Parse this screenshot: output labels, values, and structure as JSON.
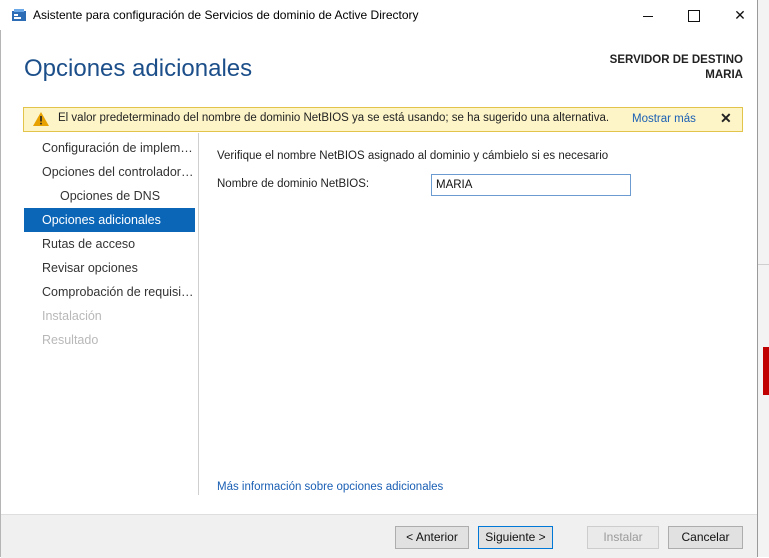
{
  "window": {
    "title": "Asistente para configuración de Servicios de dominio de Active Directory",
    "app_icon": "ad-wizard-icon"
  },
  "header": {
    "title": "Opciones adicionales",
    "dest_label": "SERVIDOR DE DESTINO",
    "dest_name": "MARIA"
  },
  "warning": {
    "icon": "warning-icon",
    "text": "El valor predeterminado del nombre de dominio NetBIOS ya se está usando; se ha sugerido una alternativa.",
    "link": "Mostrar más",
    "close": "✕"
  },
  "nav": {
    "items": [
      {
        "label": "Configuración de implementación",
        "state": "normal",
        "sub": false
      },
      {
        "label": "Opciones del controlador de dominio",
        "state": "normal",
        "sub": false
      },
      {
        "label": "Opciones de DNS",
        "state": "normal",
        "sub": true
      },
      {
        "label": "Opciones adicionales",
        "state": "active",
        "sub": false
      },
      {
        "label": "Rutas de acceso",
        "state": "normal",
        "sub": false
      },
      {
        "label": "Revisar opciones",
        "state": "normal",
        "sub": false
      },
      {
        "label": "Comprobación de requisitos previos",
        "state": "normal",
        "sub": false
      },
      {
        "label": "Instalación",
        "state": "disabled",
        "sub": false
      },
      {
        "label": "Resultado",
        "state": "disabled",
        "sub": false
      }
    ]
  },
  "content": {
    "instruction": "Verifique el nombre NetBIOS asignado al dominio y cámbielo si es necesario",
    "netbios_label": "Nombre de dominio NetBIOS:",
    "netbios_value": "MARIA",
    "more_info_link": "Más información sobre opciones adicionales"
  },
  "footer": {
    "previous": "< Anterior",
    "next": "Siguiente >",
    "install": "Instalar",
    "cancel": "Cancelar"
  },
  "colors": {
    "title_blue": "#1c4f8a",
    "nav_active": "#0b66b8",
    "link": "#1a5fb4",
    "warning_bg": "#fdf5c8",
    "warning_border": "#e3c44a"
  }
}
